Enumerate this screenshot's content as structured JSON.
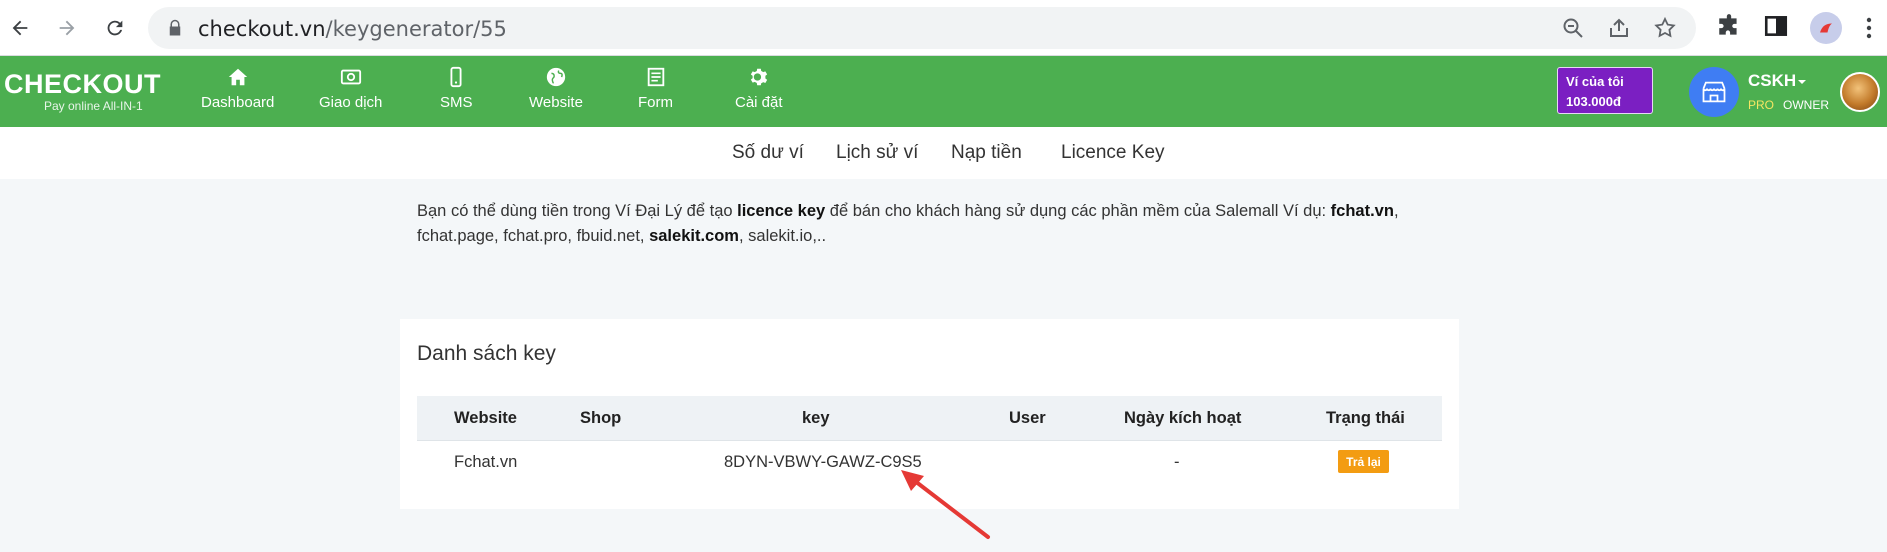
{
  "browser": {
    "url_host": "checkout.vn",
    "url_path": "/keygenerator/55"
  },
  "header": {
    "logo_main": "CHECKOUT",
    "logo_tagline": "Pay online All-IN-1",
    "menu": [
      {
        "label": "Dashboard",
        "icon": "home-icon"
      },
      {
        "label": "Giao dịch",
        "icon": "money-icon"
      },
      {
        "label": "SMS",
        "icon": "phone-icon"
      },
      {
        "label": "Website",
        "icon": "globe-icon"
      },
      {
        "label": "Form",
        "icon": "form-icon"
      },
      {
        "label": "Cài đặt",
        "icon": "gear-icon"
      }
    ],
    "wallet_label": "Ví của tôi",
    "wallet_amount": "103.000đ",
    "account_name": "CSKH",
    "tag_pro": "PRO",
    "tag_owner": "OWNER"
  },
  "subnav": {
    "items": [
      "Số dư ví",
      "Lịch sử ví",
      "Nạp tiền",
      "Licence Key"
    ]
  },
  "intro": {
    "t1": "Bạn có thể dùng tiền trong Ví Đại Lý để tạo ",
    "b1": "licence key",
    "t2": " để bán cho khách hàng sử dụng các phần mềm của Salemall Ví dụ: ",
    "b2": "fchat.vn",
    "t3": ", fchat.page, fchat.pro, fbuid.net, ",
    "b3": "salekit.com",
    "t4": ", salekit.io,.."
  },
  "key_list": {
    "title": "Danh sách key",
    "columns": [
      "Website",
      "Shop",
      "key",
      "User",
      "Ngày kích hoạt",
      "Trạng thái"
    ],
    "rows": [
      {
        "website": "Fchat.vn",
        "shop": "",
        "key": "8DYN-VBWY-GAWZ-C9S5",
        "user": "",
        "activated": "-",
        "status_button": "Trả lại"
      }
    ]
  },
  "colors": {
    "header_green": "#4caf50",
    "wallet_purple": "#7b1fc2",
    "status_orange": "#f39c12",
    "annotation_red": "#e53935"
  }
}
